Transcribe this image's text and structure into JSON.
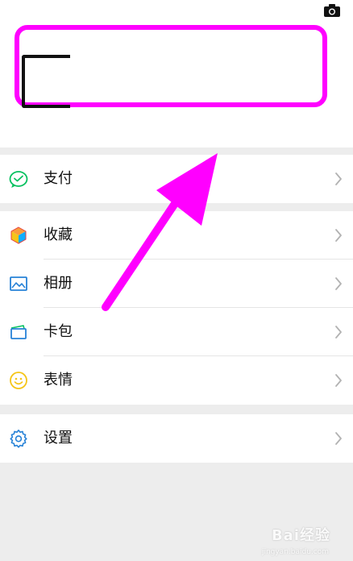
{
  "menu": {
    "pay": {
      "label": "支付",
      "icon": "wechat-pay-icon"
    },
    "favorites": {
      "label": "收藏",
      "icon": "favorites-cube-icon"
    },
    "album": {
      "label": "相册",
      "icon": "album-image-icon"
    },
    "cards": {
      "label": "卡包",
      "icon": "card-wallet-icon"
    },
    "stickers": {
      "label": "表情",
      "icon": "smiley-icon"
    },
    "settings": {
      "label": "设置",
      "icon": "gear-icon"
    }
  },
  "annotation": {
    "box_color": "#ff00ff",
    "arrow_color": "#ff00ff"
  },
  "watermark": {
    "text": "Bai经验",
    "sub": "jingyan.baidu.com"
  },
  "colors": {
    "page_bg": "#ededed",
    "card_bg": "#ffffff",
    "chevron": "#b2b2b2",
    "wechat_green": "#07c160"
  }
}
